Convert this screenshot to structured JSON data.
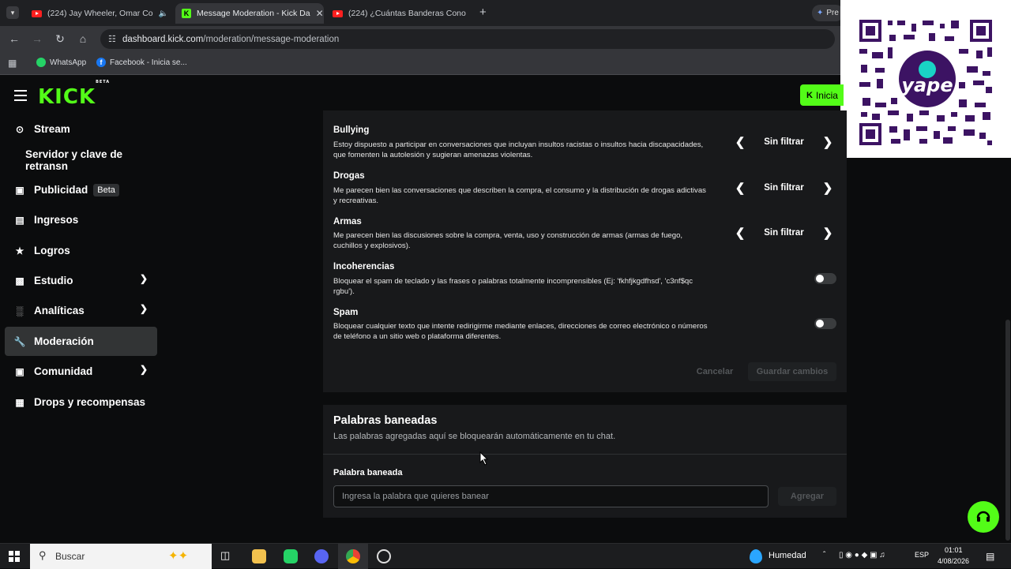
{
  "browser": {
    "tabs": [
      {
        "title": "(224) Jay Wheeler, Omar Co",
        "icon": "youtube-icon",
        "active": false
      },
      {
        "title": "Message Moderation - Kick Da",
        "icon": "kick-icon",
        "active": true
      },
      {
        "title": "(224) ¿Cuántas Banderas Cono",
        "icon": "youtube-icon",
        "active": false
      }
    ],
    "profile_label": "Pre",
    "url_host": "dashboard.kick.com",
    "url_path": "/moderation/message-moderation",
    "bookmarks": [
      {
        "label": "WhatsApp",
        "icon": "whatsapp-icon"
      },
      {
        "label": "Facebook - Inicia se...",
        "icon": "facebook-icon"
      }
    ]
  },
  "header": {
    "logo": "KICK",
    "logo_badge": "BETA",
    "login_label": "Inicia"
  },
  "qr_overlay": {
    "brand": "yape"
  },
  "sidebar": {
    "items": [
      {
        "label": "Stream",
        "icon": "broadcast-icon"
      },
      {
        "label": "Servidor y clave de retransn",
        "icon": ""
      },
      {
        "label": "Publicidad",
        "badge": "Beta",
        "icon": "ad-icon"
      },
      {
        "label": "Ingresos",
        "icon": "chart-icon"
      },
      {
        "label": "Logros",
        "icon": "trophy-icon"
      },
      {
        "label": "Estudio",
        "icon": "studio-icon",
        "expandable": true
      },
      {
        "label": "Analíticas",
        "icon": "analytics-icon",
        "expandable": true
      },
      {
        "label": "Moderación",
        "icon": "wrench-icon",
        "selected": true
      },
      {
        "label": "Comunidad",
        "icon": "community-icon",
        "expandable": true
      },
      {
        "label": "Drops y recompensas",
        "icon": "gift-icon"
      }
    ]
  },
  "filters": [
    {
      "title": "Bullying",
      "desc": "Estoy dispuesto a participar en conversaciones que incluyan insultos racistas o insultos hacia discapacidades, que fomenten la autolesión y sugieran amenazas violentas.",
      "value": "Sin filtrar"
    },
    {
      "title": "Drogas",
      "desc": "Me parecen bien las conversaciones que describen la compra, el consumo y la distribución de drogas adictivas y recreativas.",
      "value": "Sin filtrar"
    },
    {
      "title": "Armas",
      "desc": "Me parecen bien las discusiones sobre la compra, venta, uso y construcción de armas (armas de fuego, cuchillos y explosivos).",
      "value": "Sin filtrar"
    }
  ],
  "toggles": [
    {
      "title": "Incoherencias",
      "desc": "Bloquear el spam de teclado y las frases o palabras totalmente incomprensibles (Ej: 'fkhfjkgdfhsd', 'c3nf$qc rgbu').",
      "on": false
    },
    {
      "title": "Spam",
      "desc": "Bloquear cualquier texto que intente redirigirme mediante enlaces, direcciones de correo electrónico o números de teléfono a un sitio web o plataforma diferentes.",
      "on": false
    }
  ],
  "actions": {
    "cancel": "Cancelar",
    "save": "Guardar cambios"
  },
  "banned": {
    "title": "Palabras baneadas",
    "subtitle": "Las palabras agregadas aquí se bloquearán automáticamente en tu chat.",
    "field_label": "Palabra baneada",
    "placeholder": "Ingresa la palabra que quieres banear",
    "add_label": "Agregar"
  },
  "taskbar": {
    "search_label": "Buscar",
    "weather": "Humedad",
    "lang": "ESP",
    "time": "01:01",
    "date": "4/08/2026"
  },
  "colors": {
    "accent": "#53fc18",
    "panel": "#18191b",
    "background": "#0b0c0d"
  }
}
